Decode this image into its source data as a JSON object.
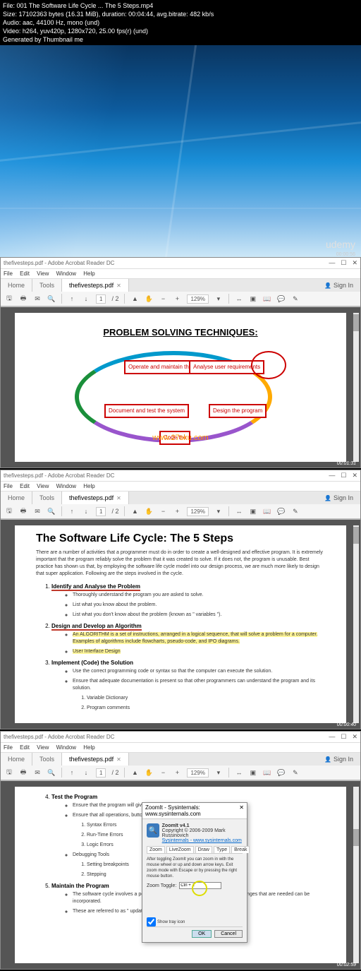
{
  "header": {
    "line1": "File: 001 The Software Life Cycle ... The 5 Steps.mp4",
    "line2": "Size: 17102363 bytes (16.31 MiB), duration: 00:04:44, avg.bitrate: 482 kb/s",
    "line3": "Audio: aac, 44100 Hz, mono (und)",
    "line4": "Video: h264, yuv420p, 1280x720, 25.00 fps(r) (und)",
    "line5": "Generated by Thumbnail me"
  },
  "wallpaper": {
    "brand": "udemy",
    "time": "00:00:56"
  },
  "acrobat": {
    "title": "thefivesteps.pdf - Adobe Acrobat Reader DC",
    "menus": [
      "File",
      "Edit",
      "View",
      "Window",
      "Help"
    ],
    "tabs": {
      "home": "Home",
      "tools": "Tools",
      "file": "thefivesteps.pdf",
      "signin": "Sign In"
    },
    "toolbar": {
      "page": "1",
      "pages": "/ 2",
      "zoom": "129%"
    }
  },
  "doc1": {
    "title": "PROBLEM SOLVING TECHNIQUES:",
    "boxes": {
      "operate": "Operate and maintain the system",
      "analyse": "Analyse user requirements",
      "doctest": "Document and test the system",
      "design": "Design the program",
      "code": "Code the"
    },
    "wm": "www.27sku.com",
    "time": "00:01:31"
  },
  "doc2": {
    "title": "The Software Life Cycle: The 5 Steps",
    "intro": "There are a number of activities that a programmer must do in order to create a well-designed and effective program. It is extremely important that the program reliably solve the problem that it was created to solve. If it does not, the program is unusable. Best practice has shown us that, by employing the software life cycle model into our design process, we are much more likely to design that super application. Following are the steps involved in the cycle.",
    "step1": {
      "head": "Identify and Analyse the Problem",
      "a": "Thoroughly understand the program you are asked to solve.",
      "b": "List what you know about the problem.",
      "c": "List what you don't know about the problem (known as \" variables \")."
    },
    "step2": {
      "head": "Design and Develop an Algorithm",
      "a": "An ALGORITHM is a set of instructions, arranged in a logical sequence, that will solve a problem for a computer. Examples of algorithms include flowcharts, pseudo-code, and IPO diagrams.",
      "b": "User Interface Design"
    },
    "step3": {
      "head": "Implement (Code) the Solution",
      "a": "Use the correct programming code or syntax so that the computer can execute the solution.",
      "b": "Ensure that adequate documentation is present so that other programmers can understand the program and its solution.",
      "b1": "Variable Dictionary",
      "b2": "Program comments"
    },
    "time": "00:00:40"
  },
  "doc3": {
    "step4": {
      "head": "Test the Program",
      "a": "Ensure that the program will giv",
      "b": "Ensure that all operations, butto",
      "b1": "Syntax Errors",
      "b2": "Run-Time Errors",
      "b3": "Logic Errors",
      "c": "Debugging Tools",
      "c1": "Setting breakpoints",
      "c2": "Stepping"
    },
    "step5": {
      "head": "Maintain the Program",
      "a": "The software cycle involves a period of time after successful testing, so that changes that are needed can be incorporated.",
      "b": "These are referred to as \" updates \""
    },
    "time": "00:02:59"
  },
  "zoomit": {
    "title": "ZoomIt - Sysinternals: www.sysinternals.com",
    "name": "ZoomIt v4.1",
    "copy": "Copyright © 2006-2009 Mark Russinovich",
    "link": "Sysinternals - www.sysinternals.com",
    "tabs": [
      "Zoom",
      "LiveZoom",
      "Draw",
      "Type",
      "Break"
    ],
    "desc": "After toggling ZoomIt you can zoom in with the mouse wheel or up and down arrow keys. Exit zoom mode with Escape or by pressing the right mouse button.",
    "toggleLabel": "Zoom Toggle:",
    "toggleVal": "Ctrl + 1",
    "tray": "Show tray icon",
    "ok": "OK",
    "cancel": "Cancel"
  }
}
